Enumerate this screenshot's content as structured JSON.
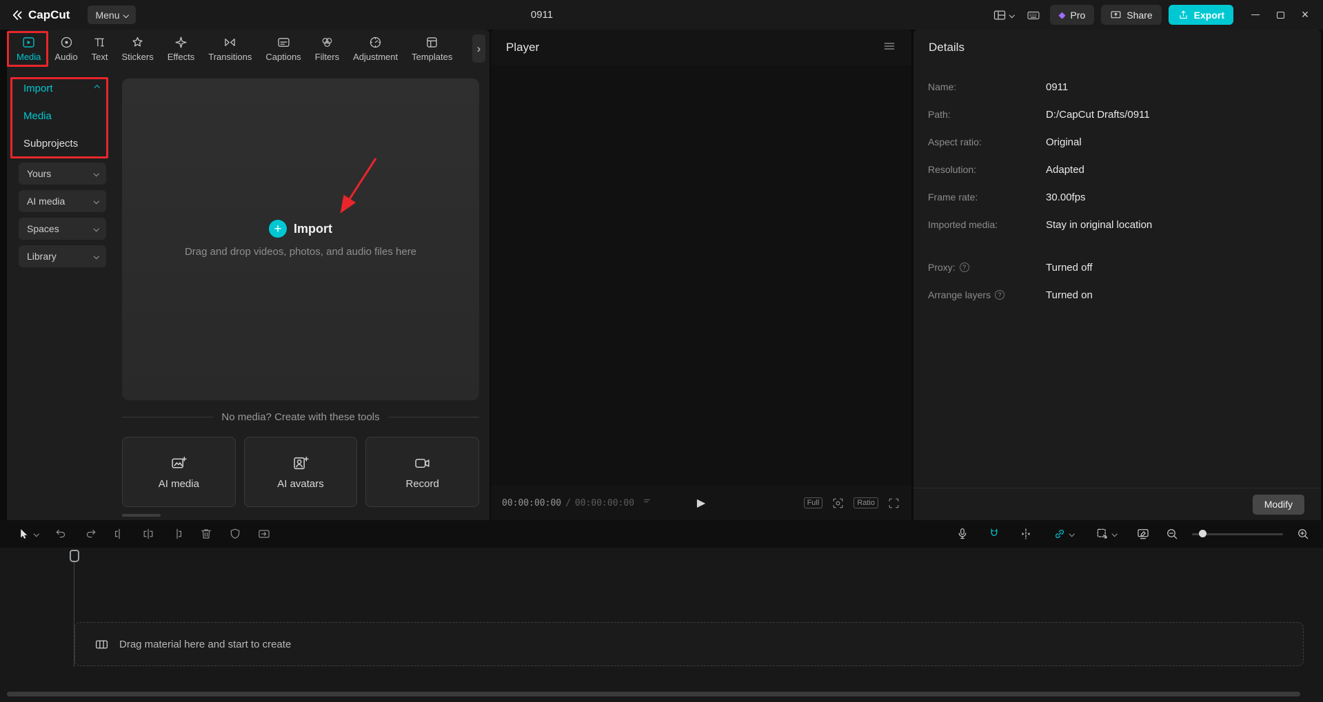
{
  "colors": {
    "accent": "#00c8d2",
    "annotation": "#e8262b",
    "pro_gem": "#a06eff"
  },
  "icons": {
    "plus": "+",
    "play": "▶",
    "close": "×",
    "info": "?",
    "pro_gem": "◆",
    "more": "›"
  },
  "titlebar": {
    "logo_text": "CapCut",
    "menu_label": "Menu",
    "project_title": "0911",
    "pro_label": "Pro",
    "share_label": "Share",
    "export_label": "Export"
  },
  "ribbon": {
    "tabs": [
      {
        "label": "Media"
      },
      {
        "label": "Audio"
      },
      {
        "label": "Text"
      },
      {
        "label": "Stickers"
      },
      {
        "label": "Effects"
      },
      {
        "label": "Transitions"
      },
      {
        "label": "Captions"
      },
      {
        "label": "Filters"
      },
      {
        "label": "Adjustment"
      },
      {
        "label": "Templates"
      }
    ]
  },
  "sidebar": {
    "import_label": "Import",
    "import_items": [
      {
        "label": "Media"
      },
      {
        "label": "Subprojects"
      }
    ],
    "groups": [
      {
        "label": "Yours"
      },
      {
        "label": "AI media"
      },
      {
        "label": "Spaces"
      },
      {
        "label": "Library"
      }
    ]
  },
  "media_panel": {
    "import_button": "Import",
    "drop_hint": "Drag and drop videos, photos, and audio files here",
    "tools_divider": "No media? Create with these tools",
    "tools": [
      {
        "label": "AI media"
      },
      {
        "label": "AI avatars"
      },
      {
        "label": "Record"
      }
    ]
  },
  "player": {
    "title": "Player",
    "current_time": "00:00:00:00",
    "time_separator": "/",
    "total_time": "00:00:00:00",
    "full_label": "Full",
    "ratio_label": "Ratio"
  },
  "details": {
    "title": "Details",
    "rows": [
      {
        "label": "Name:",
        "value": "0911"
      },
      {
        "label": "Path:",
        "value": "D:/CapCut Drafts/0911"
      },
      {
        "label": "Aspect ratio:",
        "value": "Original"
      },
      {
        "label": "Resolution:",
        "value": "Adapted"
      },
      {
        "label": "Frame rate:",
        "value": "30.00fps"
      },
      {
        "label": "Imported media:",
        "value": "Stay in original location"
      }
    ],
    "extra_rows": [
      {
        "label": "Proxy:",
        "value": "Turned off"
      },
      {
        "label": "Arrange layers",
        "value": "Turned on"
      }
    ],
    "modify_label": "Modify"
  },
  "timeline": {
    "drop_hint": "Drag material here and start to create"
  }
}
